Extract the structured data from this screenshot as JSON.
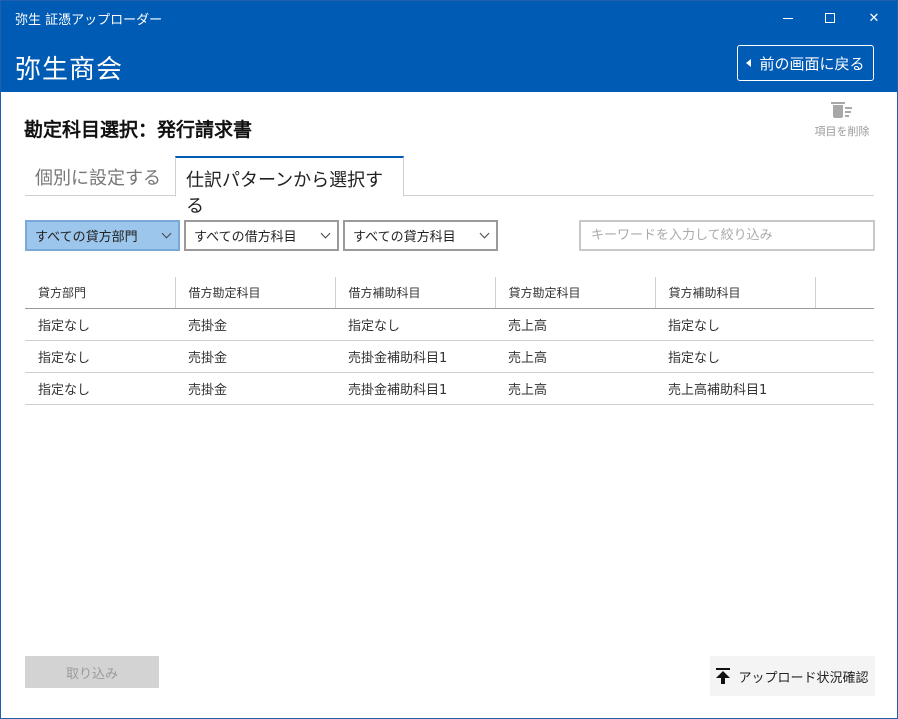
{
  "app": {
    "title": "弥生 証憑アップローダー"
  },
  "header": {
    "company": "弥生商会",
    "back_label": "前の画面に戻る"
  },
  "page": {
    "title": "勘定科目選択：発行請求書",
    "delete_label": "項目を削除"
  },
  "tabs": [
    {
      "label": "個別に設定する",
      "selected": false
    },
    {
      "label": "仕訳パターンから選択する",
      "selected": true
    }
  ],
  "filters": {
    "credit_department": "すべての貸方部門",
    "debit_account": "すべての借方科目",
    "credit_account": "すべての貸方科目",
    "search_placeholder": "キーワードを入力して絞り込み",
    "search_value": ""
  },
  "table": {
    "headers": [
      "貸方部門",
      "借方勘定科目",
      "借方補助科目",
      "貸方勘定科目",
      "貸方補助科目"
    ],
    "rows": [
      [
        "指定なし",
        "売掛金",
        "指定なし",
        "売上高",
        "指定なし"
      ],
      [
        "指定なし",
        "売掛金",
        "売掛金補助科目1",
        "売上高",
        "指定なし"
      ],
      [
        "指定なし",
        "売掛金",
        "売掛金補助科目1",
        "売上高",
        "売上高補助科目1"
      ]
    ]
  },
  "footer": {
    "import_label": "取り込み",
    "upload_status_label": "アップロード状況確認"
  },
  "colors": {
    "brand": "#005bb5",
    "selected_filter": "#9cc6ec"
  }
}
